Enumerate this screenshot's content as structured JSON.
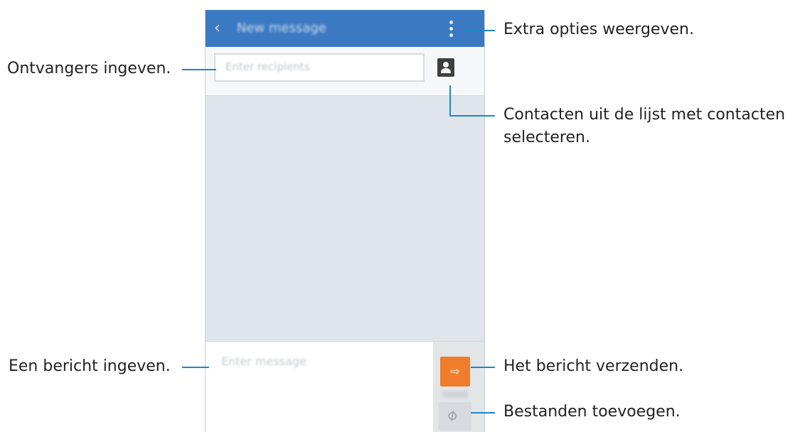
{
  "app": {
    "title": "New message"
  },
  "recipient": {
    "placeholder": "Enter recipients"
  },
  "composer": {
    "placeholder": "Enter message"
  },
  "icons": {
    "back": "chevron-left-icon",
    "more": "more-vertical-icon",
    "contacts": "contact-card-icon",
    "send": "send-icon",
    "attach": "paperclip-icon"
  },
  "colors": {
    "appbar": "#3b79c3",
    "send_button": "#ef7d2b",
    "callout_line": "#1f86c8"
  },
  "callouts": {
    "more_options": "Extra opties weergeven.",
    "enter_recipients": "Ontvangers ingeven.",
    "contacts_line1": "Contacten uit de lijst met contacten",
    "contacts_line2": "selecteren.",
    "enter_message": "Een bericht ingeven.",
    "send": "Het bericht verzenden.",
    "attach": "Bestanden toevoegen."
  }
}
